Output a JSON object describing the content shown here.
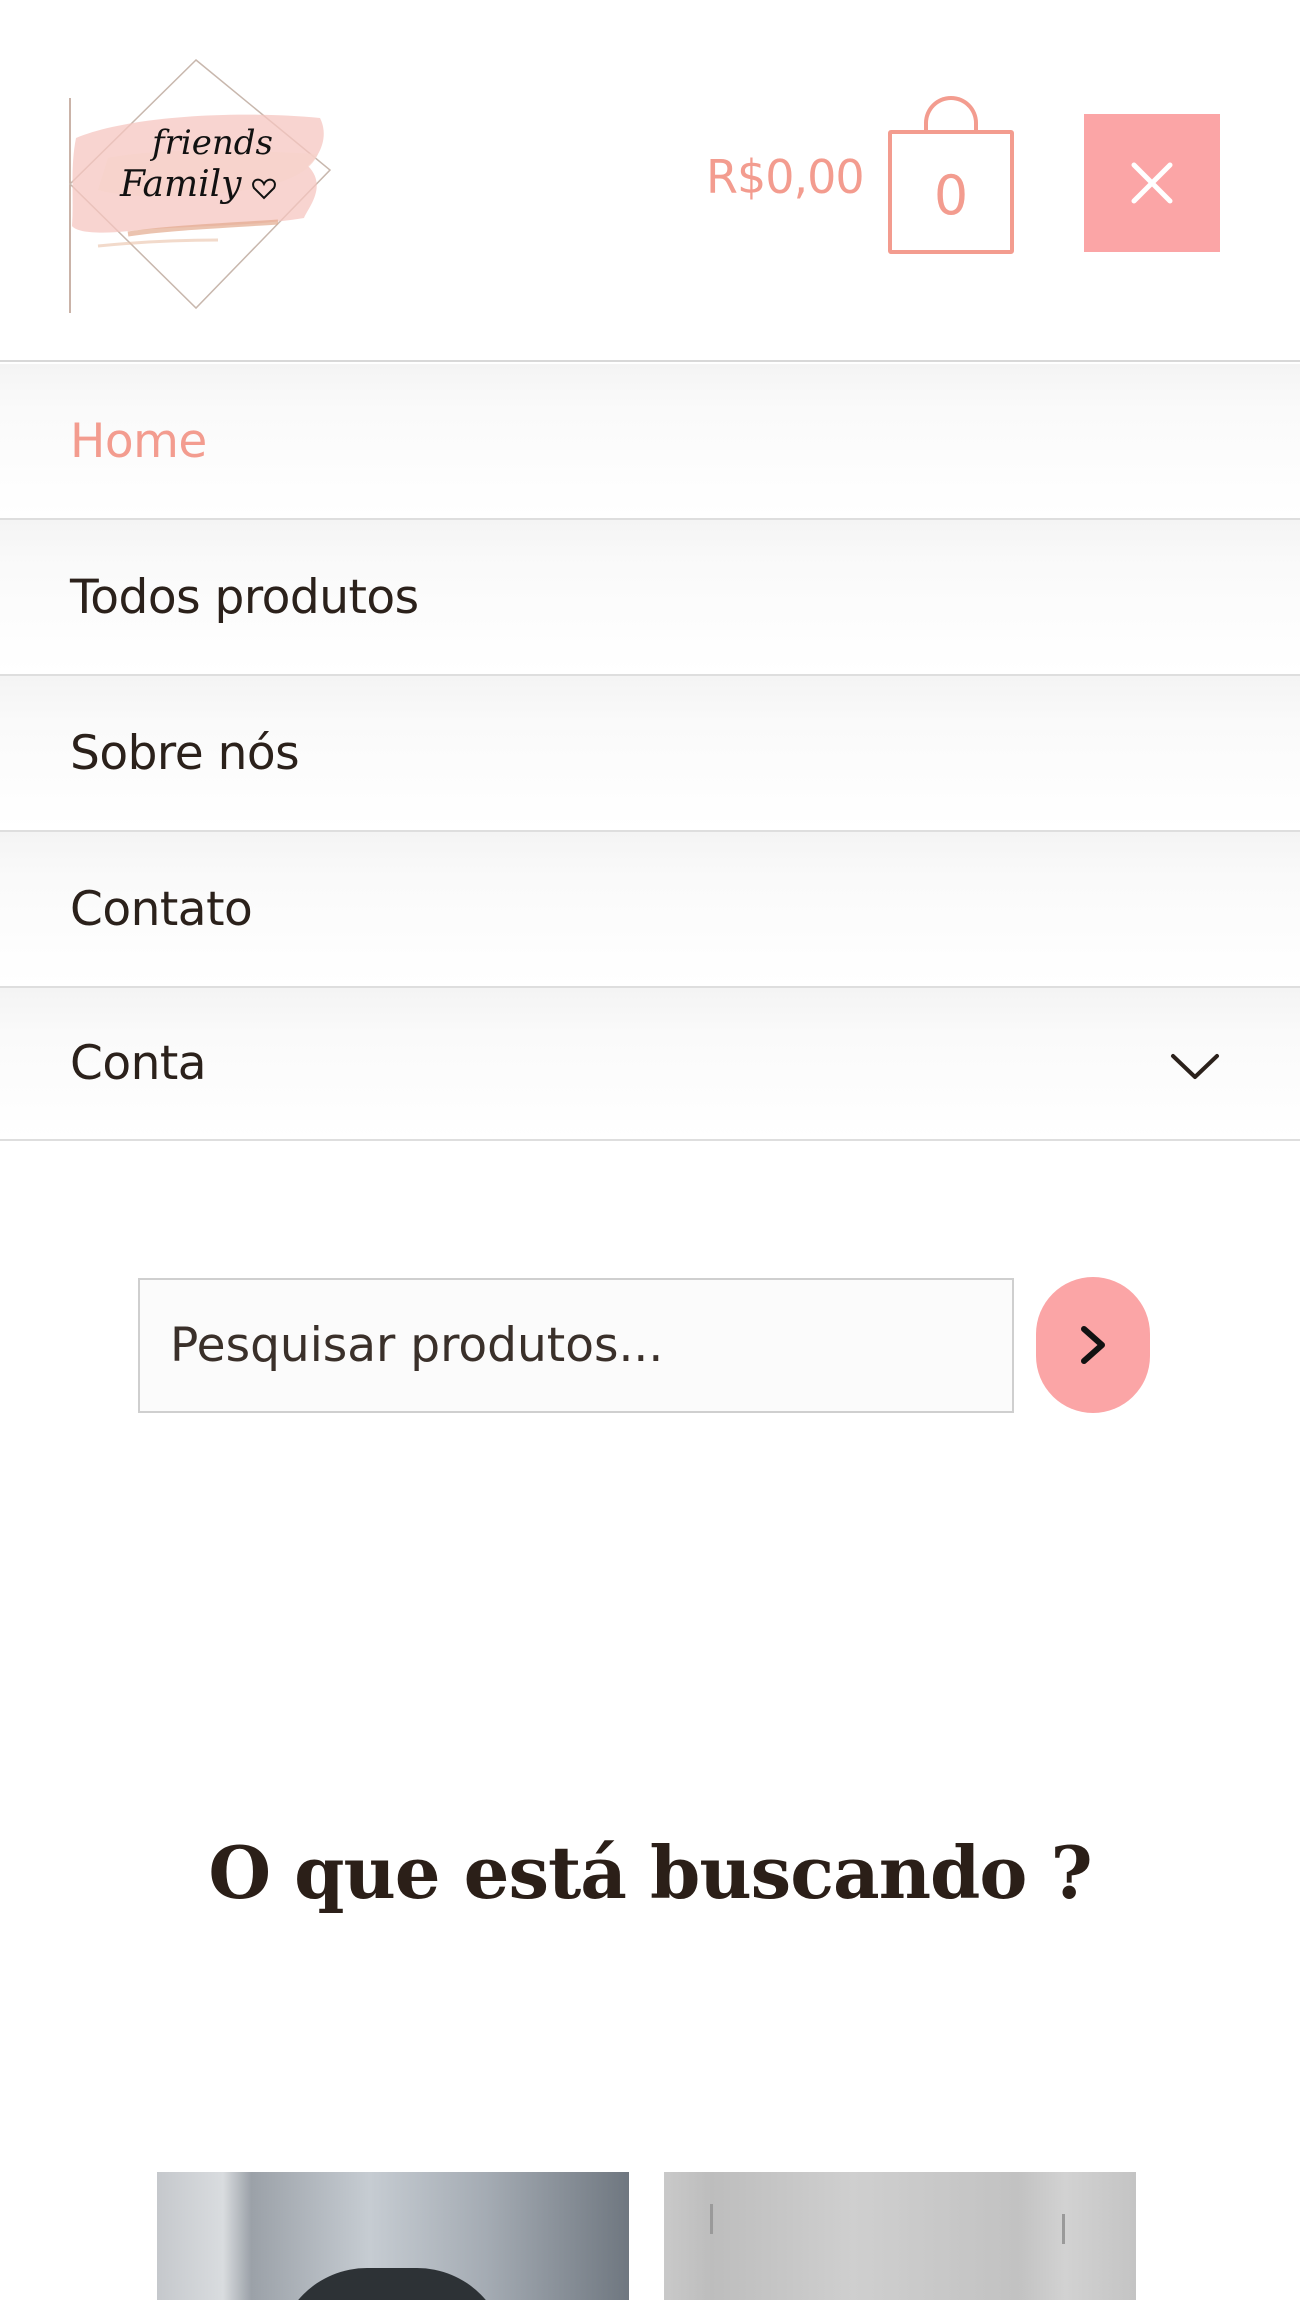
{
  "header": {
    "logo_alt": "friends Family",
    "cart_total": "R$0,00",
    "cart_count": "0",
    "close_icon": "close-icon"
  },
  "menu": {
    "items": [
      {
        "label": "Home",
        "active": true
      },
      {
        "label": "Todos produtos",
        "active": false
      },
      {
        "label": "Sobre nós",
        "active": false
      },
      {
        "label": "Contato",
        "active": false
      },
      {
        "label": "Conta",
        "active": false,
        "has_dropdown": true
      }
    ]
  },
  "search": {
    "placeholder": "Pesquisar produtos...",
    "button_icon": "chevron-right-icon"
  },
  "section": {
    "heading": "O que está buscando ?"
  },
  "colors": {
    "accent": "#f39c8f",
    "button_bg": "#fba5a6",
    "text": "#2b211b"
  }
}
